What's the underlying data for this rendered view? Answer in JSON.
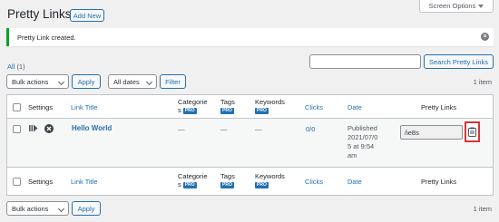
{
  "header": {
    "title": "Pretty Links",
    "add_new_label": "Add New",
    "screen_options_label": "Screen Options"
  },
  "notice": {
    "message": "Pretty Link created.",
    "dismiss_icon": "close-circle-icon"
  },
  "views": {
    "all_label": "All",
    "all_count": "(1)"
  },
  "search": {
    "button_label": "Search Pretty Links",
    "value": ""
  },
  "tablenav_top": {
    "bulk_actions": "Bulk actions",
    "apply_label": "Apply",
    "dates": "All dates",
    "filter_label": "Filter",
    "items_count": "1 item"
  },
  "table": {
    "columns": {
      "settings": "Settings",
      "link_title": "Link Title",
      "categories_line1": "Categorie",
      "categories_line2": "s",
      "tags": "Tags",
      "keywords": "Keywords",
      "clicks": "Clicks",
      "date": "Date",
      "pretty_links": "Pretty Links",
      "pro_badge": "PRO"
    },
    "rows": [
      {
        "settings_icons": [
          "redirect-arrow-icon",
          "circle-x-icon"
        ],
        "title": "Hello World",
        "categories": "—",
        "tags": "—",
        "keywords": "—",
        "clicks": "0/0",
        "date_line1": "Published",
        "date_line2": "2021/07/0",
        "date_line3": "5 at 9:54",
        "date_line4": "am",
        "pretty_link": "/ie8s",
        "copy_icon": "clipboard-icon"
      }
    ]
  },
  "tablenav_bottom": {
    "bulk_actions": "Bulk actions",
    "apply_label": "Apply",
    "items_count": "1 item"
  },
  "colors": {
    "accent": "#2271b1",
    "notice_success": "#00a32a",
    "highlight": "#d63638"
  }
}
